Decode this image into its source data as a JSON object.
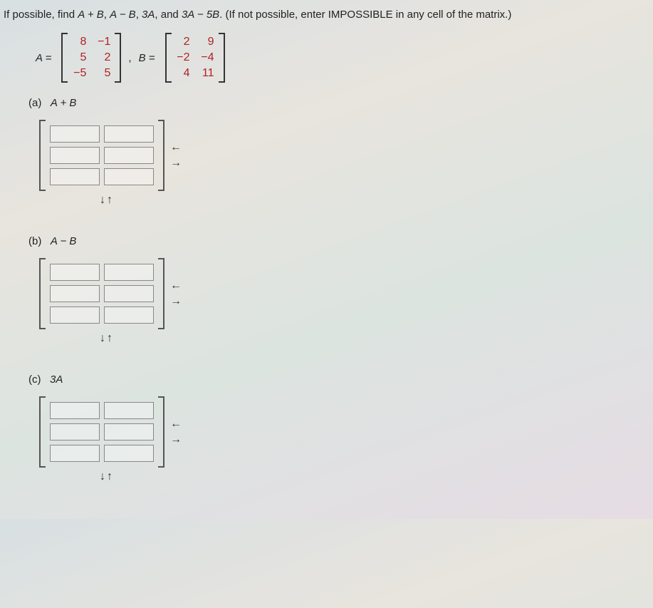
{
  "question_prefix": "If possible, find ",
  "q_expr1": "A + B",
  "q_sep1": ", ",
  "q_expr2": "A − B",
  "q_sep2": ", ",
  "q_expr3": "3A",
  "q_sep3": ", and ",
  "q_expr4": "3A − 5B",
  "question_suffix": ". (If not possible, enter IMPOSSIBLE in any cell of the matrix.)",
  "labelA": "A =",
  "labelB": "B =",
  "comma": ",",
  "matrixA": {
    "r1c1": "8",
    "r1c2": "−1",
    "r2c1": "5",
    "r2c2": "2",
    "r3c1": "−5",
    "r3c2": "5"
  },
  "matrixB": {
    "r1c1": "2",
    "r1c2": "9",
    "r2c1": "−2",
    "r2c2": "−4",
    "r3c1": "4",
    "r3c2": "11"
  },
  "parts": {
    "a": {
      "label": "(a)",
      "expr": "A + B"
    },
    "b": {
      "label": "(b)",
      "expr": "A − B"
    },
    "c": {
      "label": "(c)",
      "expr": "3A"
    }
  },
  "arrows": {
    "left": "←",
    "right": "→",
    "down": "↓",
    "up": "↑"
  }
}
